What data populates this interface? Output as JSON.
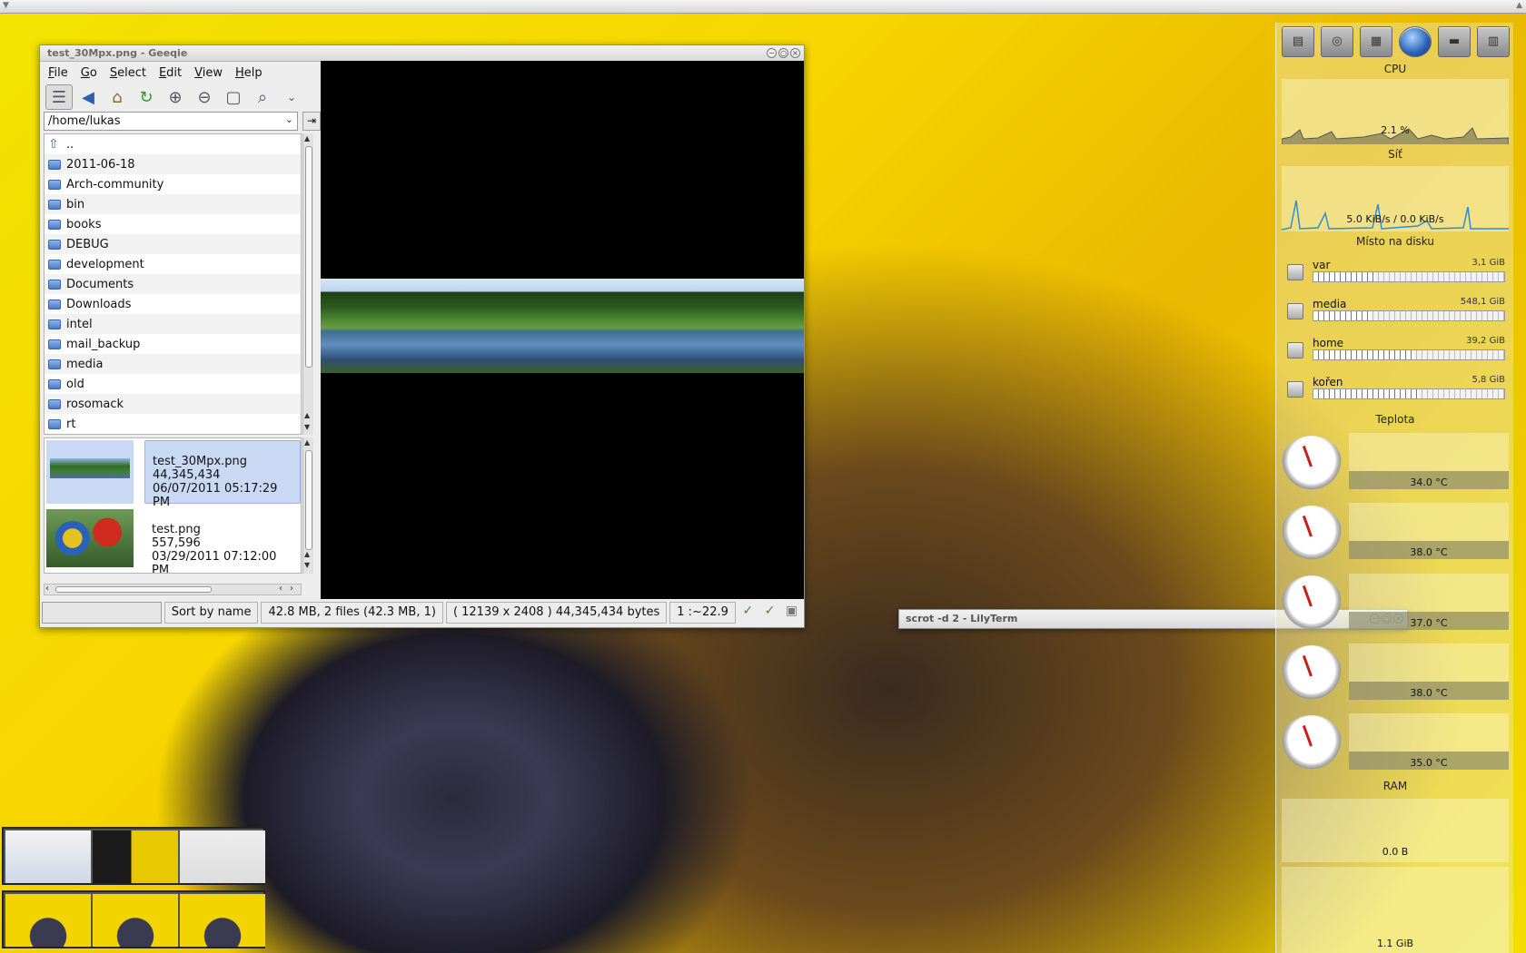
{
  "geeqie": {
    "title": "test_30Mpx.png - Geeqie",
    "menu": [
      "File",
      "Go",
      "Select",
      "Edit",
      "View",
      "Help"
    ],
    "toolbar_icons": [
      "thumbnails-icon",
      "back-icon",
      "home-icon",
      "refresh-icon",
      "zoom-in-icon",
      "zoom-out-icon",
      "zoom-fit-icon",
      "zoom-1-1-icon",
      "more-icon"
    ],
    "path": "/home/lukas",
    "folders": [
      "..",
      "2011-06-18",
      "Arch-community",
      "bin",
      "books",
      "DEBUG",
      "development",
      "Documents",
      "Downloads",
      "intel",
      "mail_backup",
      "media",
      "old",
      "rosomack",
      "rt"
    ],
    "files": [
      {
        "name": "test_30Mpx.png",
        "size": "44,345,434",
        "date": "06/07/2011 05:17:29 PM",
        "selected": true
      },
      {
        "name": "test.png",
        "size": "557,596",
        "date": "03/29/2011 07:12:00 PM",
        "selected": false
      }
    ],
    "status": {
      "sort": "Sort by name",
      "summary": "42.8 MB, 2 files (42.3 MB, 1)",
      "image_info": "( 12139 x 2408 ) 44,345,434 bytes",
      "zoom": "1 :~22.9"
    }
  },
  "lilyterm": {
    "title": "scrot -d 2 - LilyTerm"
  },
  "monitor": {
    "cpu": {
      "label": "CPU",
      "value": "2.1 %"
    },
    "net": {
      "label": "Síť",
      "value": "5.0 KiB/s / 0.0 KiB/s"
    },
    "disk": {
      "label": "Místo na disku",
      "items": [
        {
          "name": "var",
          "size": "3,1 GiB",
          "fill": 0.32
        },
        {
          "name": "media",
          "size": "548,1 GiB",
          "fill": 0.3
        },
        {
          "name": "home",
          "size": "39,2 GiB",
          "fill": 0.53
        },
        {
          "name": "kořen",
          "size": "5,8 GiB",
          "fill": 0.55
        }
      ]
    },
    "temp": {
      "label": "Teplota",
      "values": [
        "34.0 °C",
        "38.0 °C",
        "37.0 °C",
        "38.0 °C",
        "35.0 °C"
      ]
    },
    "ram": {
      "label": "RAM",
      "value1": "0.0 B",
      "value2": "1.1 GiB"
    }
  },
  "colors": {
    "selection": "#c9d9f3",
    "net_line": "#2a8ed8",
    "needle": "#c81e1e"
  }
}
